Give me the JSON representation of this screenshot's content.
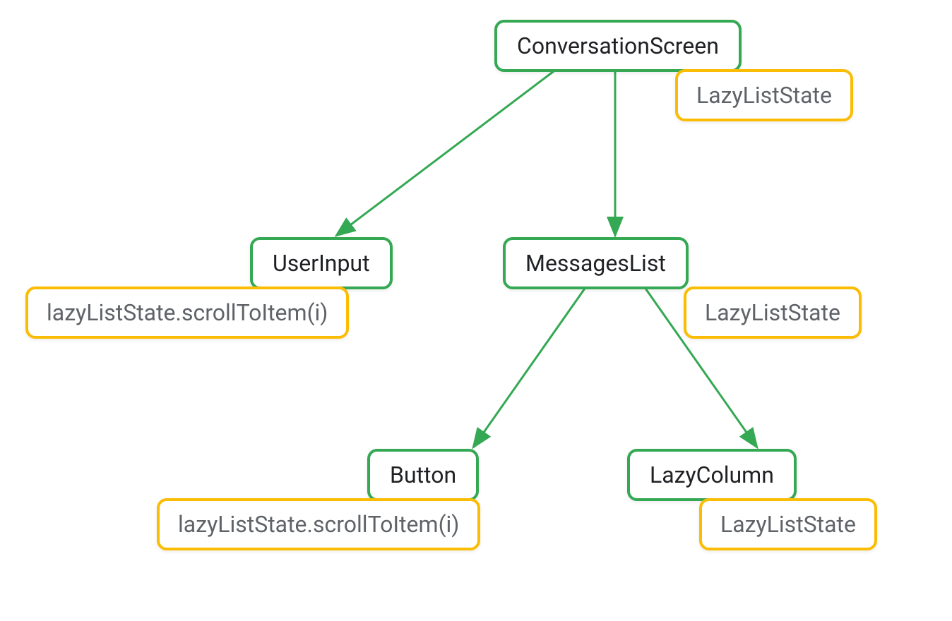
{
  "diagram": {
    "nodes": {
      "conversationScreen": {
        "label": "ConversationScreen",
        "type": "green"
      },
      "conversationScreenState": {
        "label": "LazyListState",
        "type": "yellow"
      },
      "userInput": {
        "label": "UserInput",
        "type": "green"
      },
      "userInputState": {
        "label": "lazyListState.scrollToItem(i)",
        "type": "yellow"
      },
      "messagesList": {
        "label": "MessagesList",
        "type": "green"
      },
      "messagesListState": {
        "label": "LazyListState",
        "type": "yellow"
      },
      "button": {
        "label": "Button",
        "type": "green"
      },
      "buttonState": {
        "label": "lazyListState.scrollToItem(i)",
        "type": "yellow"
      },
      "lazyColumn": {
        "label": "LazyColumn",
        "type": "green"
      },
      "lazyColumnState": {
        "label": "LazyListState",
        "type": "yellow"
      }
    },
    "edges": [
      {
        "from": "conversationScreen",
        "to": "userInput"
      },
      {
        "from": "conversationScreen",
        "to": "messagesList"
      },
      {
        "from": "messagesList",
        "to": "button"
      },
      {
        "from": "messagesList",
        "to": "lazyColumn"
      }
    ],
    "colors": {
      "green": "#34a853",
      "yellow": "#fbbc04",
      "textDark": "#202124",
      "textLight": "#5f6368"
    }
  }
}
